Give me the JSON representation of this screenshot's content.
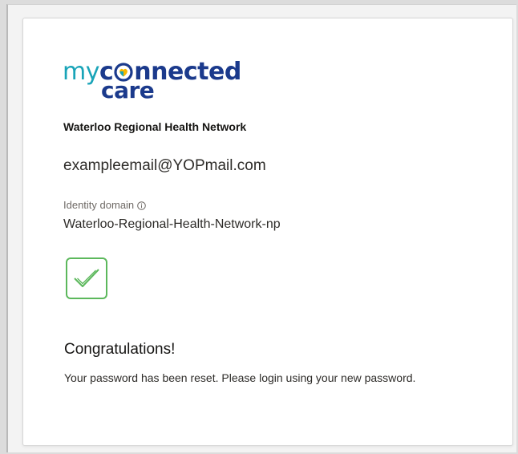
{
  "logo": {
    "part_my": "my",
    "part_c": "c",
    "part_nnected": "nnected",
    "part_care": "care"
  },
  "organization": "Waterloo Regional Health Network",
  "user": {
    "email": "exampleemail@YOPmail.com"
  },
  "identity_domain": {
    "label": "Identity domain",
    "value": "Waterloo-Regional-Health-Network-np",
    "info_icon": "info-icon"
  },
  "success": {
    "icon": "checkmark-icon",
    "title": "Congratulations!",
    "message": "Your password has been reset. Please login using your new password."
  },
  "colors": {
    "brand_teal": "#19a4b8",
    "brand_navy": "#1b3a8c",
    "heart_yellow": "#f5b800",
    "success_green": "#5cb85c"
  }
}
